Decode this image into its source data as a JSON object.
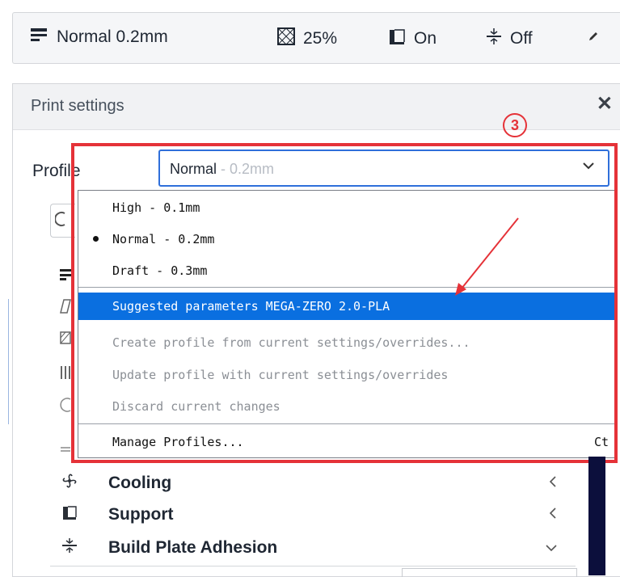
{
  "toolbar": {
    "profile": "Normal 0.2mm",
    "infill": "25%",
    "support": "On",
    "adhesion": "Off"
  },
  "panel": {
    "title": "Print settings",
    "close": "✕"
  },
  "profile": {
    "label": "Profile",
    "selected_name": "Normal",
    "selected_sub": " - 0.2mm"
  },
  "menu": {
    "items": [
      {
        "label": "High - 0.1mm"
      },
      {
        "label": "Normal - 0.2mm"
      },
      {
        "label": "Draft - 0.3mm"
      },
      {
        "label": "Suggested parameters MEGA-ZERO 2.0-PLA"
      },
      {
        "label": "Create profile from current settings/overrides..."
      },
      {
        "label": "Update profile with current settings/overrides"
      },
      {
        "label": "Discard current changes"
      },
      {
        "label": "Manage Profiles..."
      }
    ],
    "shortcut": "Ct"
  },
  "annotation": {
    "number": "3",
    "color": "#e53238"
  },
  "categories": [
    {
      "label": "Cooling"
    },
    {
      "label": "Support"
    },
    {
      "label": "Build Plate Adhesion"
    }
  ],
  "colors": {
    "accent": "#0a6fe0",
    "annotation": "#e53238"
  }
}
